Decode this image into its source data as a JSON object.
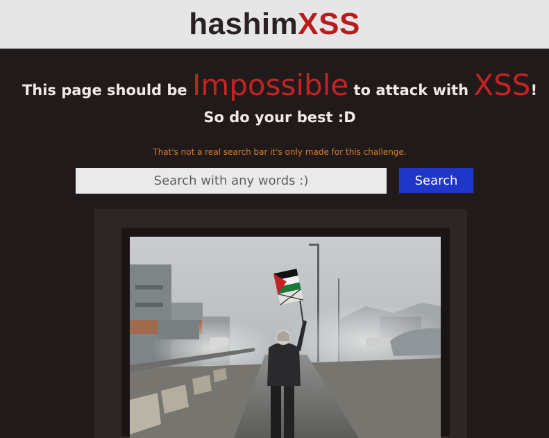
{
  "header": {
    "logo_part1": "hashim",
    "logo_part2": "XSS"
  },
  "headline": {
    "part1": "This page should be ",
    "big1": "Impossible",
    "part2": " to attack with ",
    "big2": "XSS",
    "part3": "!"
  },
  "subline": "So do your best :D",
  "note": "That's not a real search bar it's only made for this challenge.",
  "search": {
    "placeholder": "Search with any words :)",
    "button_label": "Search"
  },
  "colors": {
    "background": "#211a1b",
    "header_bg": "#e6e6e6",
    "accent_red": "#c42322",
    "note_orange": "#d97f23",
    "button_blue": "#1f36c8"
  }
}
